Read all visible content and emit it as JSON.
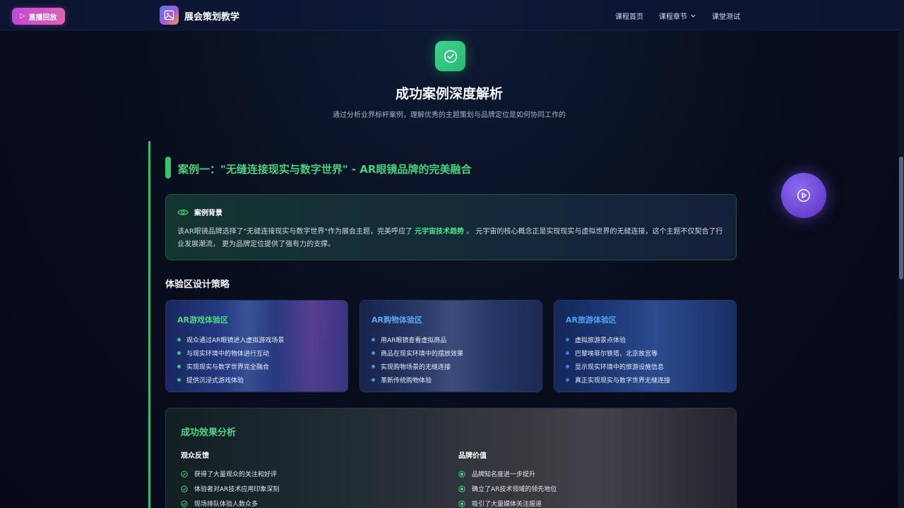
{
  "topbar": {
    "live_button": "直播回放",
    "brand": "展会策划教学",
    "nav": [
      "课程首页",
      "课程章节",
      "课堂测试"
    ]
  },
  "hero": {
    "title": "成功案例深度解析",
    "subtitle": "通过分析业界标杆案例，理解优秀的主题策划与品牌定位是如何协同工作的"
  },
  "case": {
    "title": "案例一：\"无缝连接现实与数字世界\" - AR眼镜品牌的完美融合",
    "background_heading": "案例背景",
    "background_text_1": "该AR眼镜品牌选择了\"无缝连接现实与数字世界\"作为展会主题，完美呼应了 ",
    "background_highlight": "元宇宙技术趋势",
    "background_text_2": " 。 元宇宙的核心概念正是实现现实与虚拟世界的无缝连接，这个主题不仅契合了行业发展潮流， 更为品牌定位提供了强有力的支撑。"
  },
  "strategy": {
    "heading": "体验区设计策略",
    "zones": [
      {
        "title": "AR游戏体验区",
        "items": [
          "观众通过AR眼镜进入虚拟游戏场景",
          "与现实环境中的物体进行互动",
          "实现现实与数字世界完全融合",
          "提供沉浸式游戏体验"
        ]
      },
      {
        "title": "AR购物体验区",
        "items": [
          "用AR眼镜查看虚拟商品",
          "商品在现实环境中的摆放效果",
          "实现购物场景的无缝连接",
          "革新传统购物体验"
        ]
      },
      {
        "title": "AR旅游体验区",
        "items": [
          "虚拟旅游景点体验",
          "巴黎埃菲尔铁塔、北京故宫等",
          "显示现实环境中的旅游设施信息",
          "真正实现现实与数字世界无缝连接"
        ]
      }
    ]
  },
  "effect": {
    "title": "成功效果分析",
    "feedback_heading": "观众反馈",
    "feedback_items": [
      "获得了大量观众的关注和好评",
      "体验者对AR技术应用印象深刻",
      "现场排队体验人数众多"
    ],
    "value_heading": "品牌价值",
    "value_items": [
      "品牌知名度进一步提升",
      "确立了AR技术领域的领先地位",
      "吸引了大量媒体关注报道"
    ]
  },
  "colors": {
    "accent_green": "#48d07e",
    "live_pink": "#d652c6",
    "fab_purple": "#6a3fd0"
  }
}
